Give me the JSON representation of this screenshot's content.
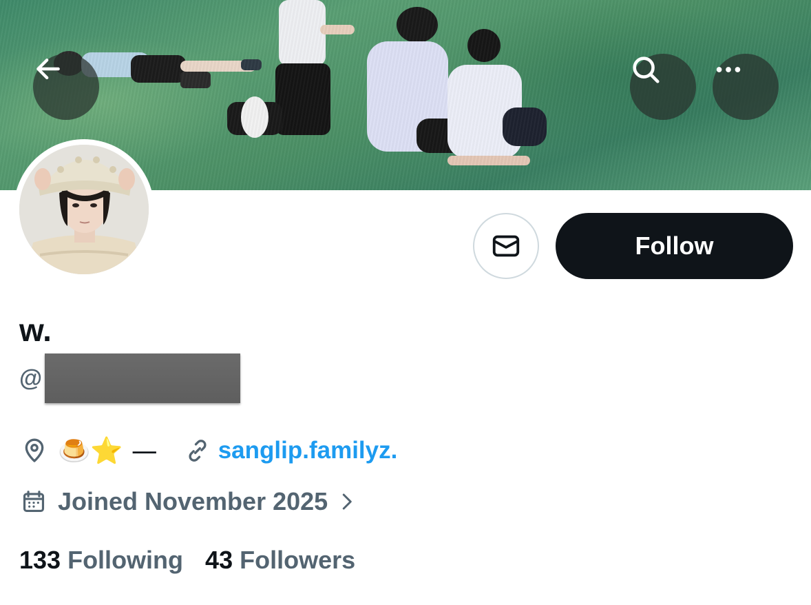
{
  "header": {
    "back_icon": "arrow-left-icon",
    "search_icon": "search-icon",
    "more_icon": "more-horizontal-icon"
  },
  "actions": {
    "message_icon": "mail-icon",
    "follow_label": "Follow"
  },
  "profile": {
    "display_name": "w.",
    "handle_prefix": "@",
    "handle_redacted": true,
    "location_icon": "location-pin-icon",
    "location_text": "🍮⭐ —",
    "link_icon": "link-icon",
    "link_text": "sanglip.familyz.",
    "joined_icon": "calendar-icon",
    "joined_text": "Joined November 2025",
    "joined_chevron_icon": "chevron-right-icon"
  },
  "stats": {
    "following_count": "133",
    "following_label": "Following",
    "followers_count": "43",
    "followers_label": "Followers"
  },
  "colors": {
    "primary_text": "#0f1419",
    "secondary_text": "#536471",
    "link": "#1d9bf0",
    "follow_bg": "#0f1419",
    "border": "#cfd9de"
  }
}
